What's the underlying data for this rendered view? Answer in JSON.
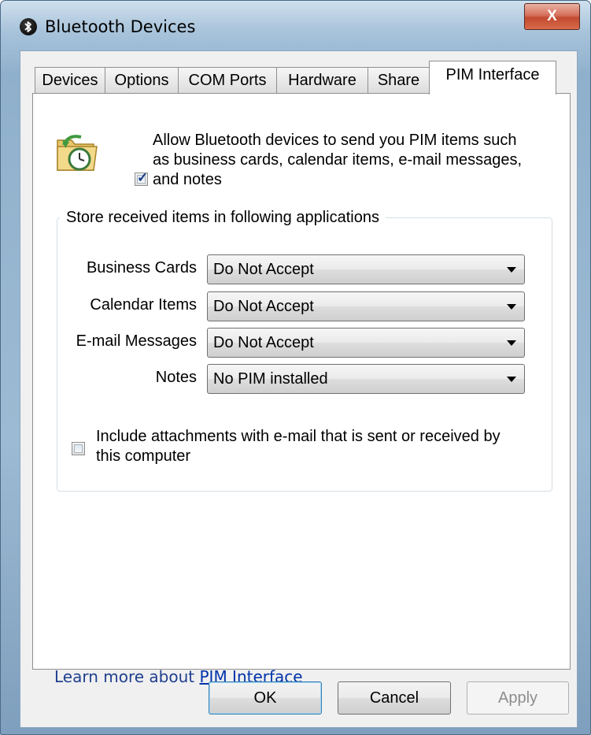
{
  "window": {
    "title": "Bluetooth Devices",
    "close_label": "X"
  },
  "tabs": [
    {
      "label": "Devices",
      "active": false
    },
    {
      "label": "Options",
      "active": false
    },
    {
      "label": "COM Ports",
      "active": false
    },
    {
      "label": "Hardware",
      "active": false
    },
    {
      "label": "Share",
      "active": false
    },
    {
      "label": "PIM Interface",
      "active": true
    }
  ],
  "pim": {
    "allow_checked": true,
    "allow_lines": [
      "Allow Bluetooth devices to send you PIM items such",
      "as business cards, calendar items, e-mail messages,",
      "and notes"
    ],
    "group_legend": "Store received items in following applications",
    "rows": [
      {
        "label": "Business Cards",
        "value": "Do Not Accept"
      },
      {
        "label": "Calendar Items",
        "value": "Do Not Accept"
      },
      {
        "label": "E-mail Messages",
        "value": "Do Not Accept"
      },
      {
        "label": "Notes",
        "value": "No PIM installed"
      }
    ],
    "attachments_checked": false,
    "attachments_lines": [
      "Include attachments with e-mail that is sent or received by",
      "this computer"
    ]
  },
  "learn_more": {
    "prefix": "Learn more about ",
    "link": "PIM Interface"
  },
  "buttons": {
    "ok": "OK",
    "cancel": "Cancel",
    "apply": "Apply"
  }
}
